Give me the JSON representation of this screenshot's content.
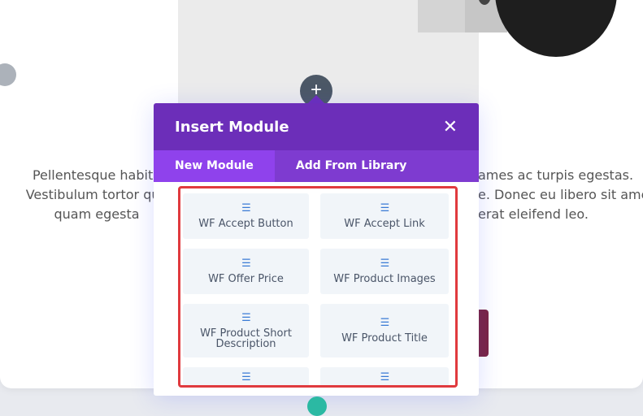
{
  "modal": {
    "title": "Insert Module",
    "close_icon": "close-icon",
    "tabs": [
      {
        "label": "New Module",
        "active": true
      },
      {
        "label": "Add From Library",
        "active": false
      }
    ],
    "modules": [
      {
        "label": "WF Accept Button",
        "icon": "module-icon"
      },
      {
        "label": "WF Accept Link",
        "icon": "module-icon"
      },
      {
        "label": "WF Offer Price",
        "icon": "module-icon"
      },
      {
        "label": "WF Product Images",
        "icon": "module-icon"
      },
      {
        "label": "WF Product Short Description",
        "icon": "module-icon"
      },
      {
        "label": "WF Product Title",
        "icon": "module-icon"
      }
    ],
    "accent_color": "#6c2eb9",
    "highlight_color": "#e03a3e"
  },
  "page": {
    "text_left": "Pellentesque habita\nVestibulum tortor qua\nquam egesta",
    "text_right": "ames ac turpis egestas.\ne. Donec eu libero sit amet\nerat eleifend leo.",
    "add_icon": "+"
  }
}
